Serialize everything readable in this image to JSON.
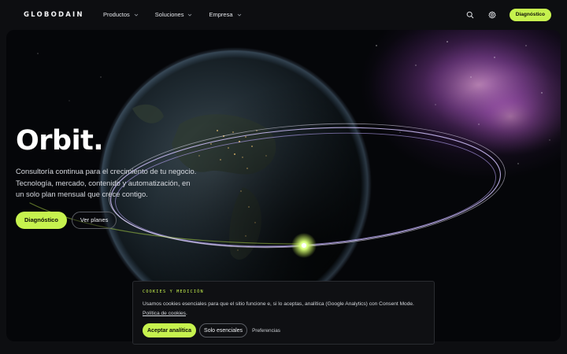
{
  "brand": {
    "logo_text": "GLOBODAIN"
  },
  "nav": {
    "items": [
      {
        "label": "Productos"
      },
      {
        "label": "Soluciones"
      },
      {
        "label": "Empresa"
      }
    ],
    "icons": [
      "search-icon",
      "gear-icon"
    ],
    "cta_label": "Diagnóstico"
  },
  "hero": {
    "title": "Orbit.",
    "description_lines": [
      "Consultoría continua para el crecimiento de tu negocio.",
      "Tecnología, mercado, contenido y automatización, en",
      "un solo plan mensual que crece contigo."
    ],
    "primary_button": "Diagnóstico",
    "secondary_button": "Ver planes"
  },
  "cookie_banner": {
    "heading": "COOKIES Y MEDICIÓN",
    "text": "Usamos cookies esenciales para que el sitio funcione e, si lo aceptas, analítica (Google Analytics) con Consent Mode.",
    "policy_link": "Política de cookies",
    "policy_suffix": ".",
    "accept_label": "Aceptar analítica",
    "essential_label": "Solo esenciales",
    "preferences_label": "Preferencias"
  },
  "colors": {
    "accent": "#c6f24e",
    "background": "#0d0e11",
    "orbit": "#c9b8ff"
  }
}
